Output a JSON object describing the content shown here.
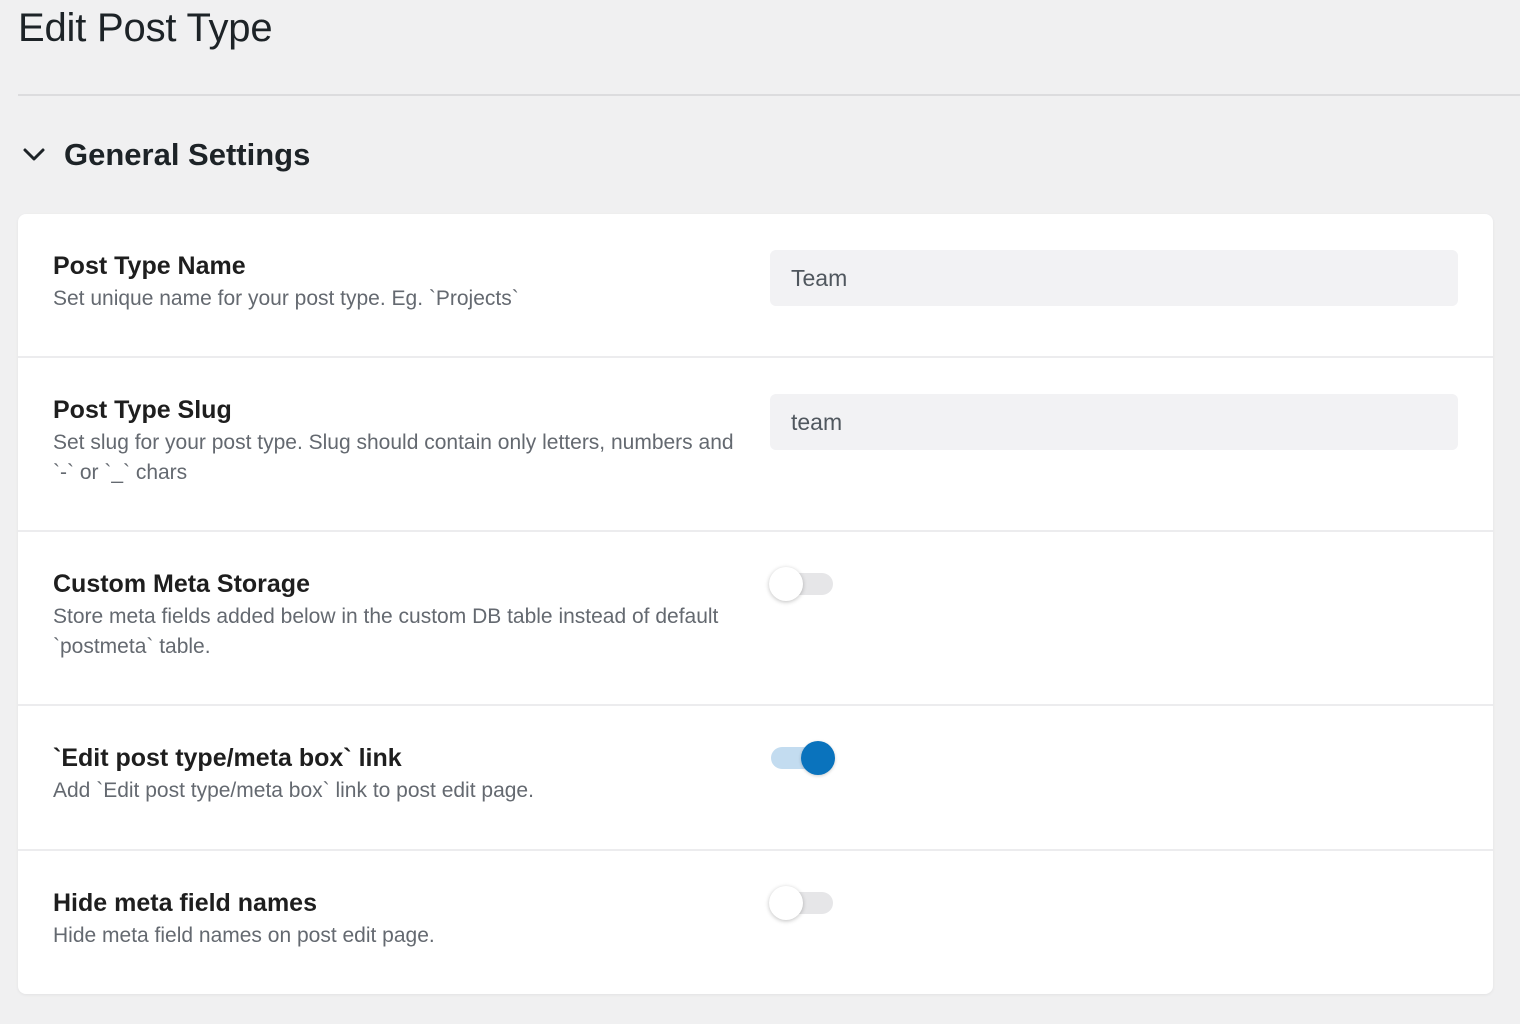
{
  "page": {
    "title": "Edit Post Type"
  },
  "section": {
    "title": "General Settings",
    "expanded": true,
    "chevron_icon": "chevron-down-icon"
  },
  "settings": [
    {
      "label": "Post Type Name",
      "description": "Set unique name for your post type. Eg. `Projects`",
      "control": "text",
      "value": "Team"
    },
    {
      "label": "Post Type Slug",
      "description": "Set slug for your post type. Slug should contain only letters, numbers and `-` or `_` chars",
      "control": "text",
      "value": "team"
    },
    {
      "label": "Custom Meta Storage",
      "description": "Store meta fields added below in the custom DB table instead of default `postmeta` table.",
      "control": "toggle",
      "checked": false
    },
    {
      "label": "`Edit post type/meta box` link",
      "description": "Add `Edit post type/meta box` link to post edit page.",
      "control": "toggle",
      "checked": true
    },
    {
      "label": "Hide meta field names",
      "description": "Hide meta field names on post edit page.",
      "control": "toggle",
      "checked": false
    }
  ],
  "colors": {
    "accent": "#0a73bd",
    "accent_track": "#c3dcf0",
    "background": "#f0f0f1",
    "card": "#ffffff"
  }
}
